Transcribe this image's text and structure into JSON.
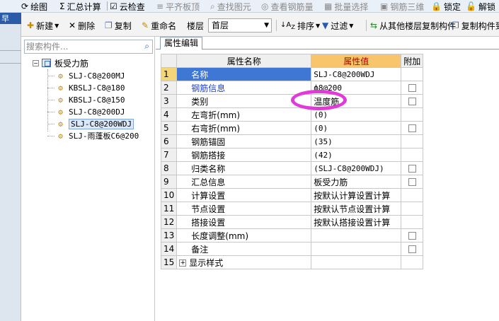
{
  "top_toolbar": {
    "items": [
      {
        "label": "绘图",
        "icon": "draw-icon",
        "icon_char": "⟳",
        "disabled": false
      },
      {
        "label": "汇总计算",
        "icon": "sigma-icon",
        "icon_char": "Σ",
        "disabled": false
      },
      {
        "label": "云检查",
        "icon": "cloud-check-icon",
        "icon_char": "☑",
        "disabled": false
      },
      {
        "label": "平齐板顶",
        "icon": "align-icon",
        "icon_char": "≡",
        "disabled": true
      },
      {
        "label": "查找图元",
        "icon": "find-icon",
        "icon_char": "⌕",
        "disabled": true
      },
      {
        "label": "查看钢筋量",
        "icon": "view-icon",
        "icon_char": "◎",
        "disabled": true
      },
      {
        "label": "批量选择",
        "icon": "batch-icon",
        "icon_char": "▦",
        "disabled": true
      },
      {
        "label": "钢筋三维",
        "icon": "3d-icon",
        "icon_char": "▣",
        "disabled": true
      },
      {
        "label": "锁定",
        "icon": "lock-icon",
        "icon_char": "🔒",
        "disabled": false
      },
      {
        "label": "解锁",
        "icon": "unlock-icon",
        "icon_char": "🔓",
        "disabled": false
      }
    ]
  },
  "left_strip": {
    "title": "早"
  },
  "toolbar": {
    "new_label": "新建",
    "delete_label": "删除",
    "copy_label": "复制",
    "rename_label": "重命名",
    "floor_label": "楼层",
    "floor_value": "首层",
    "sort_label": "排序",
    "filter_label": "过滤",
    "copy_from_floor_label": "从其他楼层复制构件",
    "copy_to_label": "复制构件到"
  },
  "search": {
    "placeholder": "搜索构件..."
  },
  "tree": {
    "root": "板受力筋",
    "items": [
      {
        "label": "SLJ-C8@200MJ",
        "selected": false
      },
      {
        "label": "KBSLJ-C8@180",
        "selected": false
      },
      {
        "label": "KBSLJ-C8@150",
        "selected": false
      },
      {
        "label": "SLJ-C8@200DJ",
        "selected": false
      },
      {
        "label": "SLJ-C8@200WDJ",
        "selected": true
      },
      {
        "label": "SLJ-雨蓬板C6@200",
        "selected": false
      }
    ]
  },
  "tab": {
    "label": "属性编辑"
  },
  "table": {
    "headers": {
      "name": "属性名称",
      "value": "属性值",
      "add": "附加"
    },
    "rows": [
      {
        "num": "1",
        "name": "名称",
        "value": "SLJ-C8@200WDJ",
        "checkbox": false,
        "blue": false,
        "selected": true
      },
      {
        "num": "2",
        "name": "钢筋信息",
        "value": "ф8@200",
        "checkbox": true,
        "blue": true,
        "selected": false
      },
      {
        "num": "3",
        "name": "类别",
        "value": "温度筋",
        "checkbox": true,
        "blue": false,
        "selected": false
      },
      {
        "num": "4",
        "name": "左弯折(mm)",
        "value": "(0)",
        "checkbox": false,
        "blue": false,
        "selected": false
      },
      {
        "num": "5",
        "name": "右弯折(mm)",
        "value": "(0)",
        "checkbox": true,
        "blue": false,
        "selected": false
      },
      {
        "num": "6",
        "name": "钢筋锚固",
        "value": "(35)",
        "checkbox": false,
        "blue": false,
        "selected": false
      },
      {
        "num": "7",
        "name": "钢筋搭接",
        "value": "(42)",
        "checkbox": false,
        "blue": false,
        "selected": false
      },
      {
        "num": "8",
        "name": "归类名称",
        "value": "(SLJ-C8@200WDJ)",
        "checkbox": true,
        "blue": false,
        "selected": false
      },
      {
        "num": "9",
        "name": "汇总信息",
        "value": "板受力筋",
        "checkbox": true,
        "blue": false,
        "selected": false
      },
      {
        "num": "10",
        "name": "计算设置",
        "value": "按默认计算设置计算",
        "checkbox": false,
        "blue": false,
        "selected": false
      },
      {
        "num": "11",
        "name": "节点设置",
        "value": "按默认节点设置计算",
        "checkbox": false,
        "blue": false,
        "selected": false
      },
      {
        "num": "12",
        "name": "搭接设置",
        "value": "按默认搭接设置计算",
        "checkbox": false,
        "blue": false,
        "selected": false
      },
      {
        "num": "13",
        "name": "长度调整(mm)",
        "value": "",
        "checkbox": true,
        "blue": false,
        "selected": false
      },
      {
        "num": "14",
        "name": "备注",
        "value": "",
        "checkbox": true,
        "blue": false,
        "selected": false
      },
      {
        "num": "15",
        "name": "显示样式",
        "value": "",
        "checkbox": false,
        "blue": false,
        "selected": false,
        "expandable": true
      }
    ]
  },
  "colors": {
    "selection_blue": "#3e78d4",
    "header_orange": "#f8c56c",
    "highlight_magenta": "#e23ad8"
  }
}
